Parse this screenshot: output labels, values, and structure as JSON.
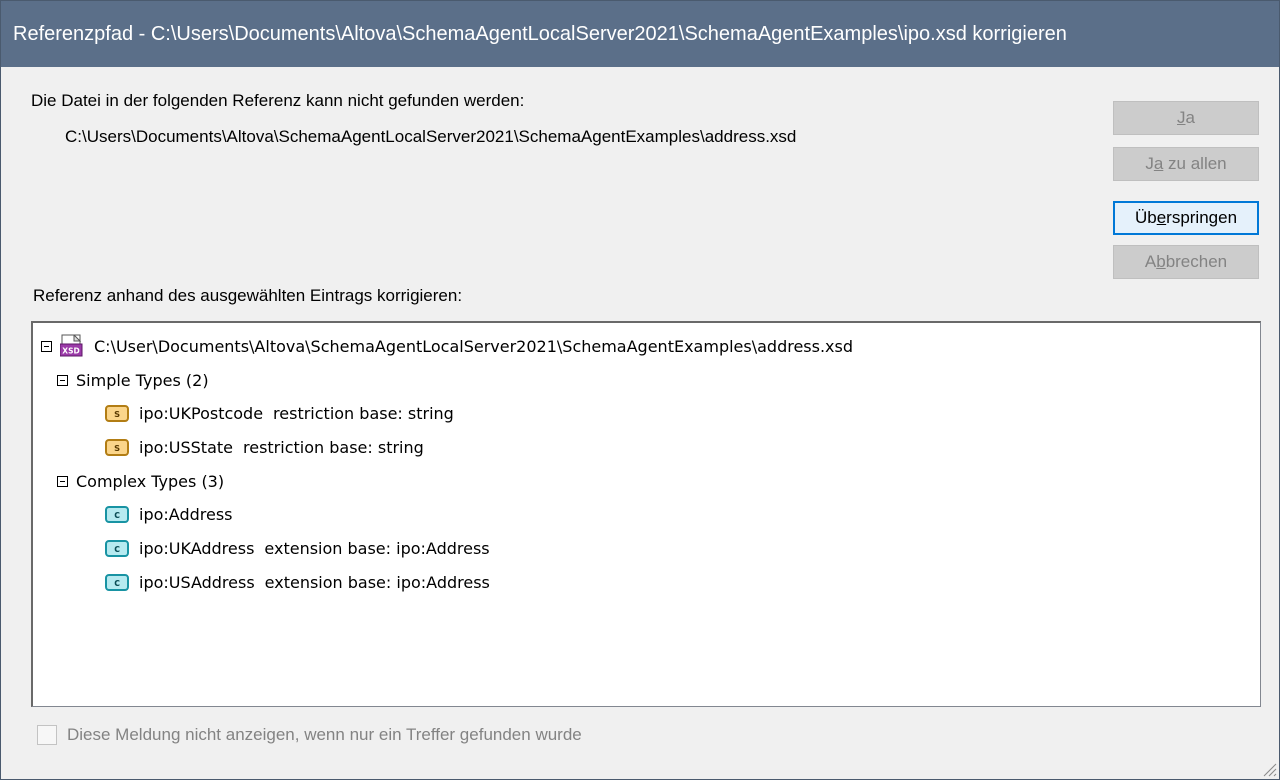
{
  "dialog": {
    "title": "Referenzpfad - C:\\Users\\Documents\\Altova\\SchemaAgentLocalServer2021\\SchemaAgentExamples\\ipo.xsd korrigieren",
    "message": "Die Datei in der folgenden Referenz kann nicht gefunden werden:",
    "missing_path": "C:\\Users\\Documents\\Altova\\SchemaAgentLocalServer2021\\SchemaAgentExamples\\address.xsd",
    "correct_label": "Referenz anhand des ausgewählten Eintrags korrigieren:"
  },
  "buttons": {
    "yes": {
      "pre": "",
      "u": "J",
      "post": "a"
    },
    "yes_all": {
      "pre": "J",
      "u": "a",
      "post": " zu allen"
    },
    "skip": {
      "pre": "Üb",
      "u": "e",
      "post": "rspringen"
    },
    "cancel": {
      "pre": "A",
      "u": "b",
      "post": "brechen"
    }
  },
  "tree": {
    "root": {
      "label": "C:\\User\\Documents\\Altova\\SchemaAgentLocalServer2021\\SchemaAgentExamples\\address.xsd",
      "icon": "xsd-file-icon"
    },
    "simple_group": "Simple Types (2)",
    "simple_items": [
      {
        "name": "ipo:UKPostcode",
        "detail": "restriction base: string",
        "icon_text": "s"
      },
      {
        "name": "ipo:USState",
        "detail": "restriction base: string",
        "icon_text": "s"
      }
    ],
    "complex_group": "Complex Types (3)",
    "complex_items": [
      {
        "name": "ipo:Address",
        "detail": "",
        "icon_text": "c"
      },
      {
        "name": "ipo:UKAddress",
        "detail": "extension base: ipo:Address",
        "icon_text": "c"
      },
      {
        "name": "ipo:USAddress",
        "detail": "extension base: ipo:Address",
        "icon_text": "c"
      }
    ]
  },
  "checkbox": {
    "label": "Diese Meldung nicht anzeigen, wenn nur ein Treffer gefunden wurde",
    "checked": false
  },
  "colors": {
    "titlebar": "#5b6f89",
    "simple_type_tag": "#fbd58a",
    "complex_type_tag": "#b6eaf0"
  }
}
